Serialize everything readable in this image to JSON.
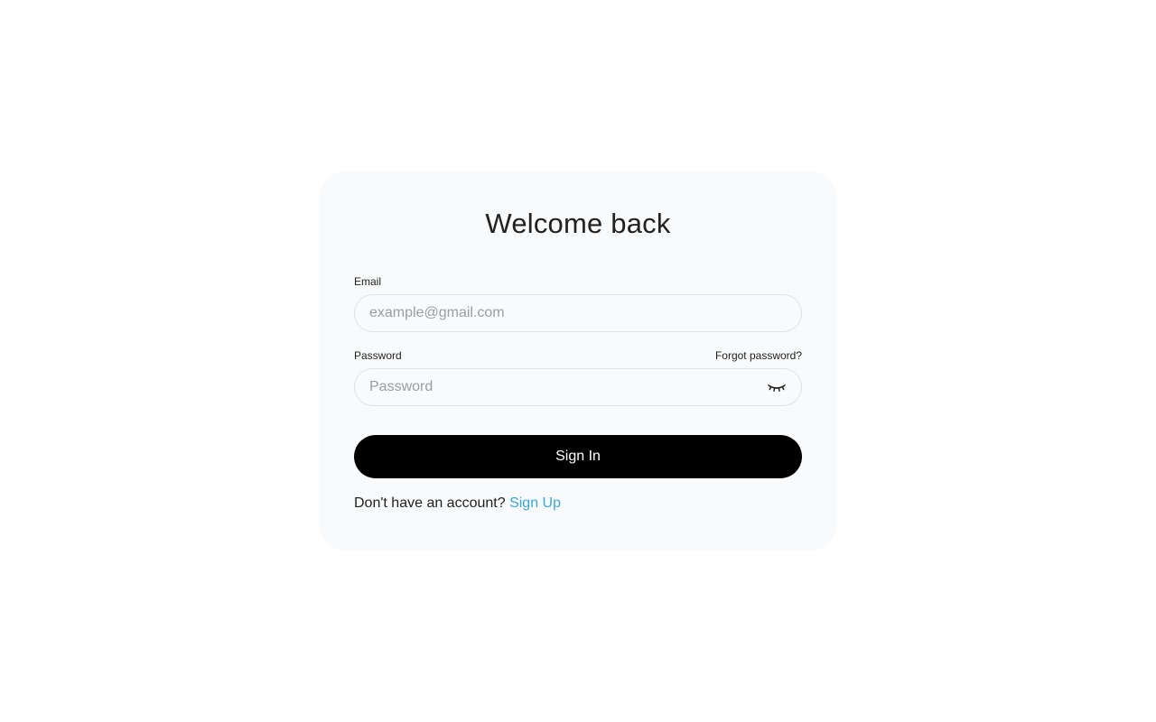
{
  "login": {
    "title": "Welcome back",
    "email": {
      "label": "Email",
      "placeholder": "example@gmail.com",
      "value": ""
    },
    "password": {
      "label": "Password",
      "placeholder": "Password",
      "value": "",
      "forgot_label": "Forgot password?",
      "toggle_icon": "eye-closed-icon"
    },
    "submit_label": "Sign In",
    "signup_prompt": "Don't have an account?",
    "signup_label": "Sign Up"
  },
  "colors": {
    "page_background": "#ffffff",
    "card_background": "#f8fafb",
    "button_background": "#000000",
    "button_text": "#ffffff",
    "link_accent": "#3aa5d6",
    "input_border": "#dfe2e5"
  }
}
